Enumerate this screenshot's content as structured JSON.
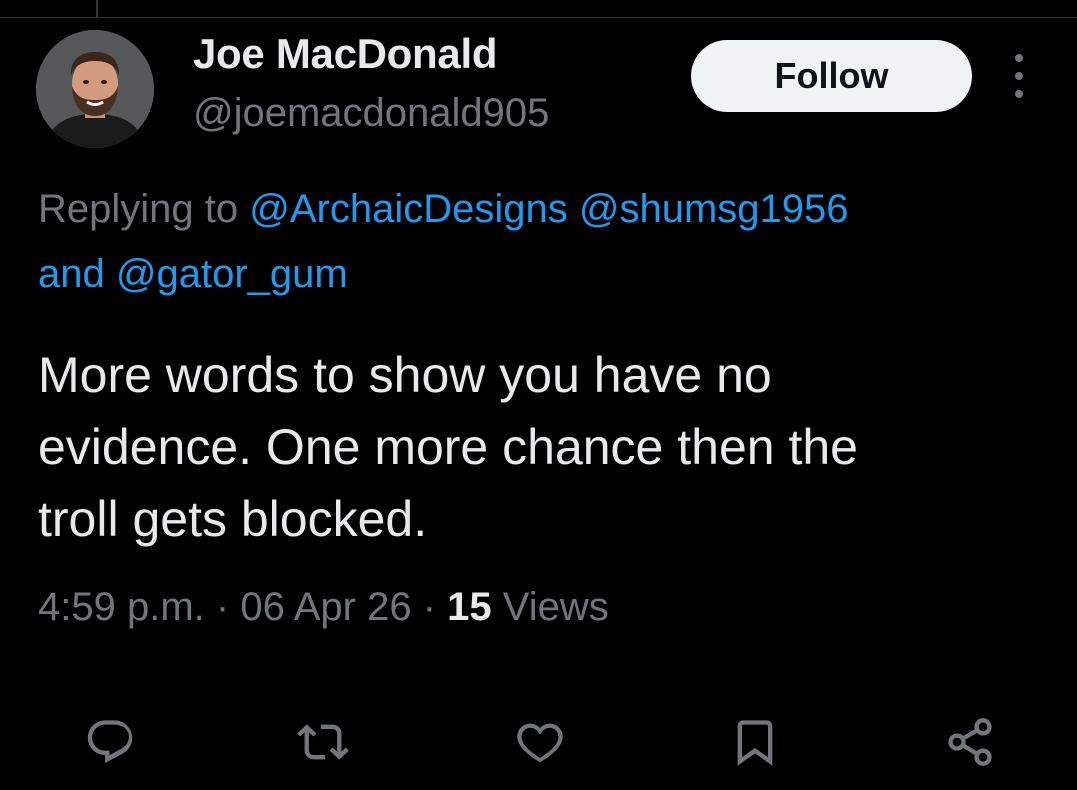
{
  "colors": {
    "background": "#000000",
    "primary_text": "#e7e9ea",
    "secondary_text": "#71767b",
    "link": "#1d9bf0",
    "follow_bg": "#eff3f4",
    "follow_text": "#0f1419"
  },
  "author": {
    "display_name": "Joe MacDonald",
    "handle": "@joemacdonald905"
  },
  "follow_label": "Follow",
  "reply": {
    "prefix": "Replying to",
    "mention_1": "@ArchaicDesigns",
    "mention_2": "@shumsg1956",
    "joiner": "and",
    "mention_3": "@gator_gum"
  },
  "tweet": {
    "line_1": "More words to show you have no",
    "line_2": "evidence. One more chance then the",
    "line_3": "troll gets blocked."
  },
  "meta": {
    "time": "4:59 p.m.",
    "separator": "·",
    "date": "06 Apr 26",
    "views_count": "15",
    "views_label": "Views"
  },
  "actions": [
    {
      "icon": "reply-icon"
    },
    {
      "icon": "retweet-icon"
    },
    {
      "icon": "like-icon"
    },
    {
      "icon": "bookmark-icon"
    },
    {
      "icon": "share-icon"
    }
  ]
}
